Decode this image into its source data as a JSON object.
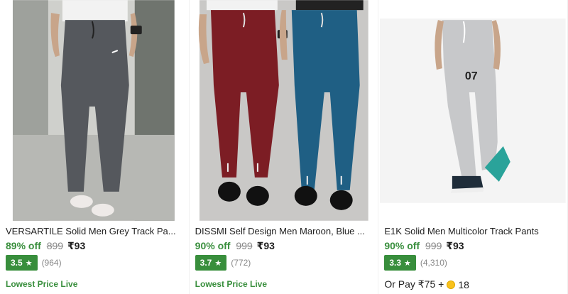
{
  "products": [
    {
      "title": "VERSARTILE Solid Men Grey Track Pa...",
      "discount": "89% off",
      "mrp": "899",
      "price": "₹93",
      "rating": "3.5",
      "reviews": "(964)",
      "tag": "Lowest Price Live"
    },
    {
      "title": "DISSMI Self Design Men Maroon, Blue ...",
      "discount": "90% off",
      "mrp": "999",
      "price": "₹93",
      "rating": "3.7",
      "reviews": "(772)",
      "tag": "Lowest Price Live"
    },
    {
      "title": "E1K Solid Men Multicolor Track Pants",
      "discount": "90% off",
      "mrp": "999",
      "price": "₹93",
      "rating": "3.3",
      "reviews": "(4,310)",
      "pay_prefix": "Or Pay ₹75 +",
      "pay_coins": "18",
      "jersey_number": "07"
    }
  ],
  "colors": {
    "green": "#388e3c",
    "grey_text": "#878787"
  },
  "icons": {
    "rating": "star-icon",
    "coin": "supercoin-icon"
  }
}
